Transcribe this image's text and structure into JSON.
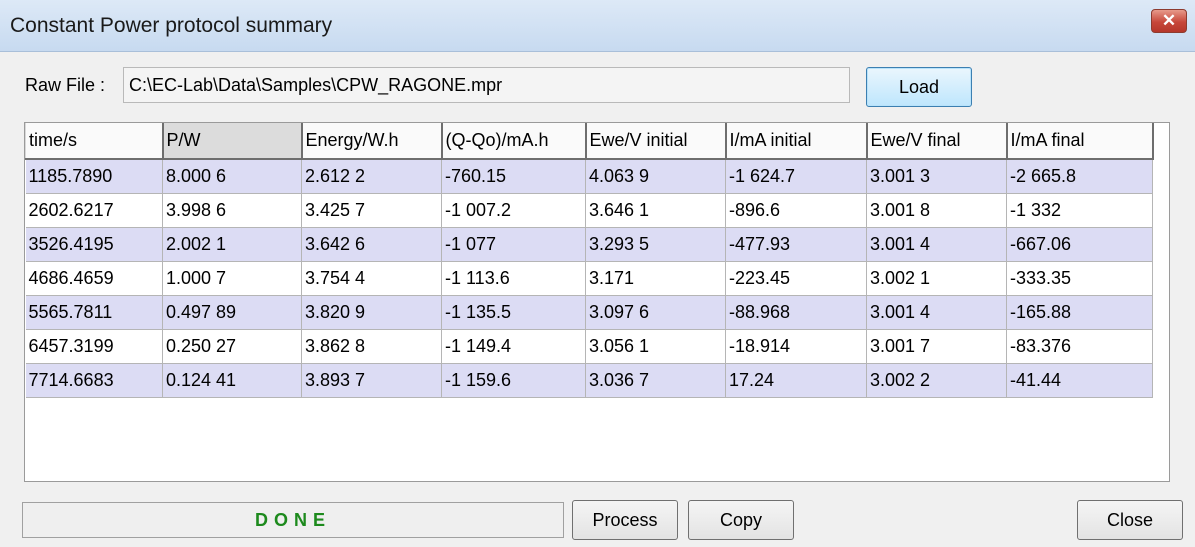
{
  "window": {
    "title": "Constant Power protocol summary",
    "close_icon": "close-x-icon",
    "close_glyph": "✕"
  },
  "raw_file": {
    "label": "Raw File :",
    "path": "C:\\EC-Lab\\Data\\Samples\\CPW_RAGONE.mpr"
  },
  "buttons": {
    "load": "Load",
    "process": "Process",
    "copy": "Copy",
    "close": "Close"
  },
  "status": {
    "text": "DONE",
    "color": "#1d8a1d"
  },
  "table": {
    "selected_column": 1,
    "row_colors": [
      "#dcdcf4",
      "#ffffff"
    ],
    "columns": [
      "time/s",
      "P/W",
      "Energy/W.h",
      "(Q-Qo)/mA.h",
      "Ewe/V initial",
      "I/mA initial",
      "Ewe/V final",
      "I/mA final"
    ],
    "rows": [
      [
        "1185.7890",
        "8.000 6",
        "2.612 2",
        "-760.15",
        "4.063 9",
        "-1 624.7",
        "3.001 3",
        "-2 665.8"
      ],
      [
        "2602.6217",
        "3.998 6",
        "3.425 7",
        "-1 007.2",
        "3.646 1",
        "-896.6",
        "3.001 8",
        "-1 332"
      ],
      [
        "3526.4195",
        "2.002 1",
        "3.642 6",
        "-1 077",
        "3.293 5",
        "-477.93",
        "3.001 4",
        "-667.06"
      ],
      [
        "4686.4659",
        "1.000 7",
        "3.754 4",
        "-1 113.6",
        "3.171",
        "-223.45",
        "3.002 1",
        "-333.35"
      ],
      [
        "5565.7811",
        "0.497 89",
        "3.820 9",
        "-1 135.5",
        "3.097 6",
        "-88.968",
        "3.001 4",
        "-165.88"
      ],
      [
        "6457.3199",
        "0.250 27",
        "3.862 8",
        "-1 149.4",
        "3.056 1",
        "-18.914",
        "3.001 7",
        "-83.376"
      ],
      [
        "7714.6683",
        "0.124 41",
        "3.893 7",
        "-1 159.6",
        "3.036 7",
        "17.24",
        "3.002 2",
        "-41.44"
      ]
    ]
  }
}
